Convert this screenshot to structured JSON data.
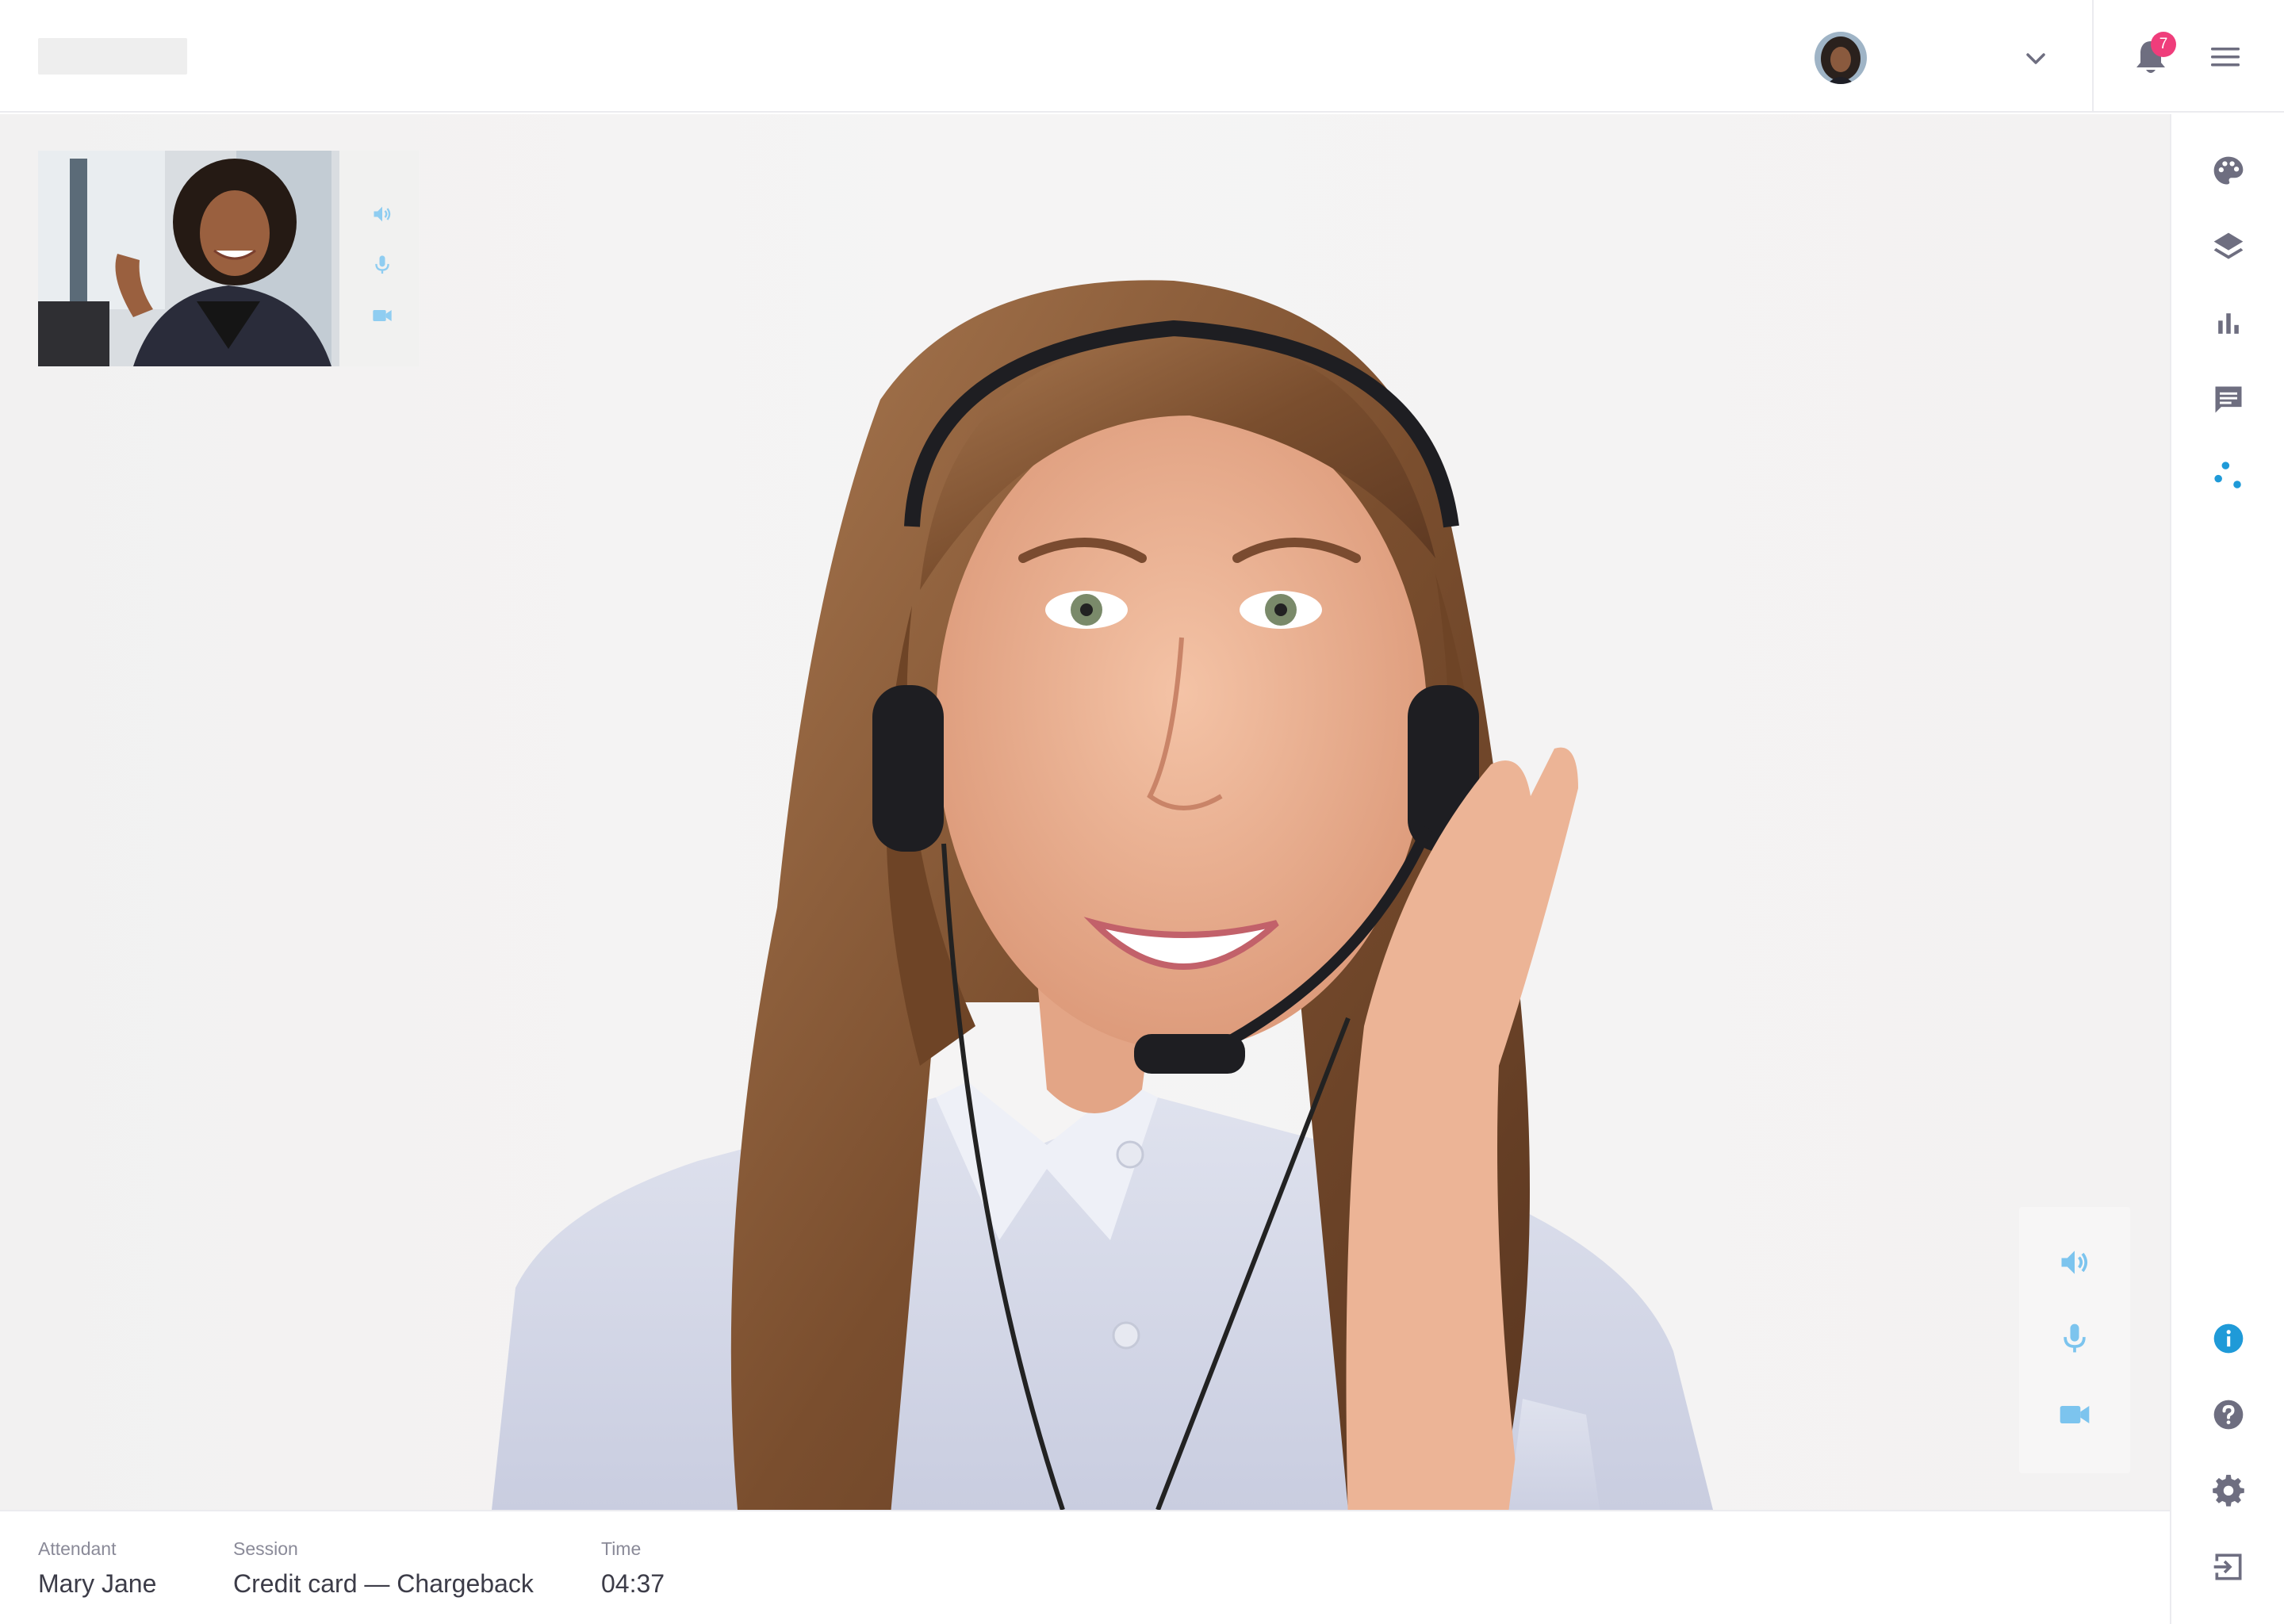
{
  "header": {
    "notifications_count": "7",
    "icons": {
      "user_menu": "chevron-down-icon",
      "notifications": "bell-icon",
      "main_menu": "hamburger-menu-icon"
    }
  },
  "selfview": {
    "controls": [
      "speaker-icon",
      "microphone-icon",
      "video-camera-icon"
    ]
  },
  "call_controls": {
    "buttons": [
      "speaker-icon",
      "microphone-icon",
      "video-camera-icon"
    ],
    "accent_color": "#7cc4ee"
  },
  "rail": {
    "top_items": [
      "palette-icon",
      "layers-icon",
      "bar-chart-icon",
      "chat-icon",
      "connect-icon"
    ],
    "bottom_items": [
      "info-icon",
      "help-icon",
      "settings-icon",
      "logout-icon"
    ],
    "active_item": "connect-icon",
    "accent_color": "#1f9ad8",
    "icon_color": "#6e6e80"
  },
  "session": {
    "attendant_label": "Attendant",
    "attendant_value": "Mary Jane",
    "session_label": "Session",
    "session_value": "Credit card — Chargeback",
    "time_label": "Time",
    "time_value": "04:37"
  }
}
